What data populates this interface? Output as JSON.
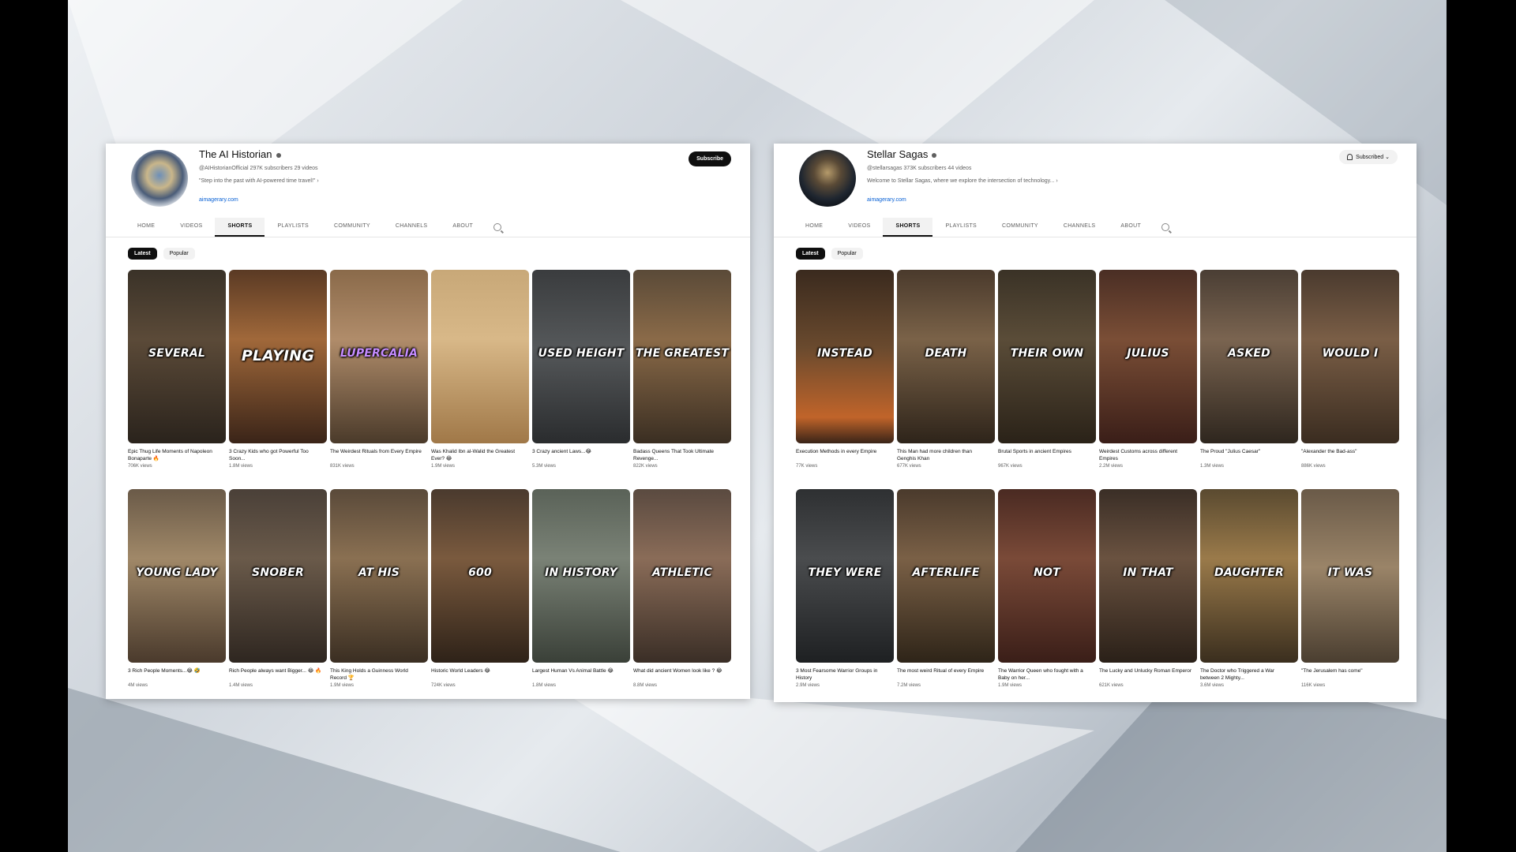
{
  "left": {
    "channel": {
      "name": "The AI Historian",
      "meta": "@AIHistorianOfficial  297K subscribers  29 videos",
      "description": "\"Step into the past with AI-powered time travel!\"  ›",
      "link": "aimagerary.com",
      "subscribe_label": "Subscribe"
    },
    "tabs": [
      "HOME",
      "VIDEOS",
      "SHORTS",
      "PLAYLISTS",
      "COMMUNITY",
      "CHANNELS",
      "ABOUT"
    ],
    "active_tab": "SHORTS",
    "chips": [
      "Latest",
      "Popular"
    ],
    "shorts": [
      {
        "word": "SEVERAL",
        "title": "Epic Thug Life Moments of Napoleon Bonaparte 🔥",
        "views": "706K views"
      },
      {
        "word": "PLAYING",
        "title": "3 Crazy Kids who got Powerful Too Soon...",
        "views": "1.8M views"
      },
      {
        "word": "LUPERCALIA",
        "title": "The Weirdest Rituals from Every Empire",
        "views": "831K views"
      },
      {
        "word": "",
        "title": "Was Khalid Ibn al-Walid the Greatest Ever? 😂",
        "views": "1.9M views"
      },
      {
        "word": "USED HEIGHT",
        "title": "3 Crazy ancient Laws...😂",
        "views": "5.3M views"
      },
      {
        "word": "THE GREATEST",
        "title": "Badass Queens That Took Ultimate Revenge...",
        "views": "822K views"
      },
      {
        "word": "YOUNG LADY",
        "title": "3 Rich People Moments...😂 🤣",
        "views": "4M views"
      },
      {
        "word": "SNOBER",
        "title": "Rich People always want Bigger... 😂 🔥",
        "views": "1.4M views"
      },
      {
        "word": "AT HIS",
        "title": "This King Holds a Guinness World Record 🏆",
        "views": "1.9M views"
      },
      {
        "word": "600",
        "title": "Historic World Leaders 😂",
        "views": "724K views"
      },
      {
        "word": "IN HISTORY",
        "title": "Largest Human Vs Animal Battle 😂",
        "views": "1.8M views"
      },
      {
        "word": "ATHLETIC",
        "title": "What did ancient Women look like ? 😂",
        "views": "8.8M views"
      }
    ]
  },
  "right": {
    "channel": {
      "name": "Stellar Sagas",
      "meta": "@stellarsagas  373K subscribers  44 videos",
      "description": "Welcome to Stellar Sagas, where we explore the intersection of technology...  ›",
      "link": "aimagerary.com",
      "subscribed_label": "Subscribed ⌄"
    },
    "tabs": [
      "HOME",
      "VIDEOS",
      "SHORTS",
      "PLAYLISTS",
      "COMMUNITY",
      "CHANNELS",
      "ABOUT"
    ],
    "active_tab": "SHORTS",
    "chips": [
      "Latest",
      "Popular"
    ],
    "shorts": [
      {
        "word": "INSTEAD",
        "title": "Execution Methods in every Empire",
        "views": "77K views"
      },
      {
        "word": "DEATH",
        "title": "This Man had more children than Genghis Khan",
        "views": "677K views"
      },
      {
        "word": "THEIR OWN",
        "title": "Brutal Sports in ancient Empires",
        "views": "967K views"
      },
      {
        "word": "JULIUS",
        "title": "Weirdest Customs across different Empires",
        "views": "2.2M views"
      },
      {
        "word": "ASKED",
        "title": "The Proud \"Julius Caesar\"",
        "views": "1.3M views"
      },
      {
        "word": "WOULD I",
        "title": "\"Alexander the Bad-ass\"",
        "views": "886K views"
      },
      {
        "word": "THEY WERE",
        "title": "3 Most Fearsome Warrior Groups in History",
        "views": "2.9M views"
      },
      {
        "word": "AFTERLIFE",
        "title": "The most weird Ritual of every Empire",
        "views": "7.2M views"
      },
      {
        "word": "NOT",
        "title": "The Warrior Queen who fought with a Baby on her...",
        "views": "1.9M views"
      },
      {
        "word": "IN THAT",
        "title": "The Lucky and Unlucky Roman Emperor",
        "views": "621K views"
      },
      {
        "word": "DAUGHTER",
        "title": "The Doctor who Triggered a War between 2 Mighty...",
        "views": "3.6M views"
      },
      {
        "word": "IT WAS",
        "title": "\"The Jerusalem has come\"",
        "views": "116K views"
      }
    ]
  },
  "colors": {
    "subscribe_bg": "#0f0f0f",
    "link": "#065fd4",
    "accent_purple": "#c58cff"
  }
}
